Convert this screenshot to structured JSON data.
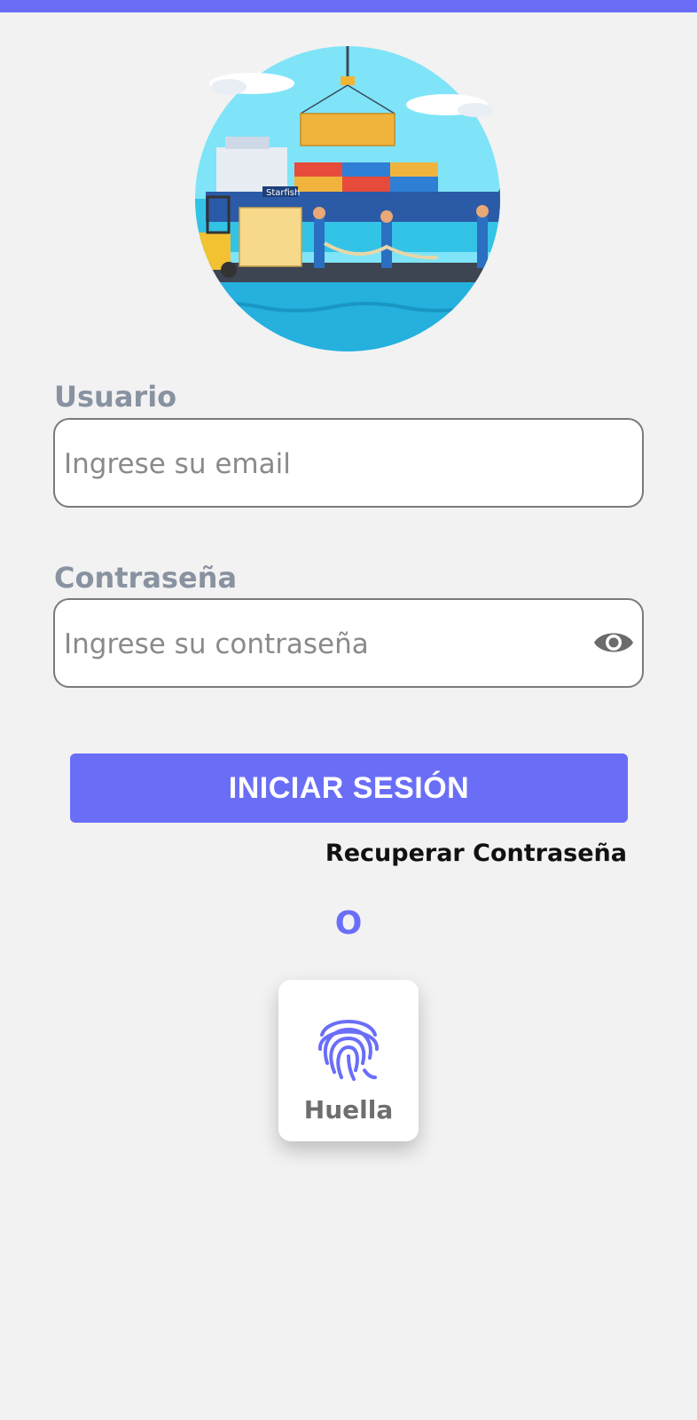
{
  "colors": {
    "accent": "#6a6ef7",
    "background": "#f2f2f2"
  },
  "hero": {
    "icon": "cargo-port-illustration",
    "ship_name": "Starfish"
  },
  "username": {
    "label": "Usuario",
    "placeholder": "Ingrese su email"
  },
  "password": {
    "label": "Contraseña",
    "placeholder": "Ingrese su contraseña",
    "toggle_icon": "eye-icon"
  },
  "login_button": "INICIAR SESIÓN",
  "recover_link": "Recuperar Contraseña",
  "or_text": "O",
  "fingerprint": {
    "label": "Huella",
    "icon": "fingerprint-icon"
  }
}
